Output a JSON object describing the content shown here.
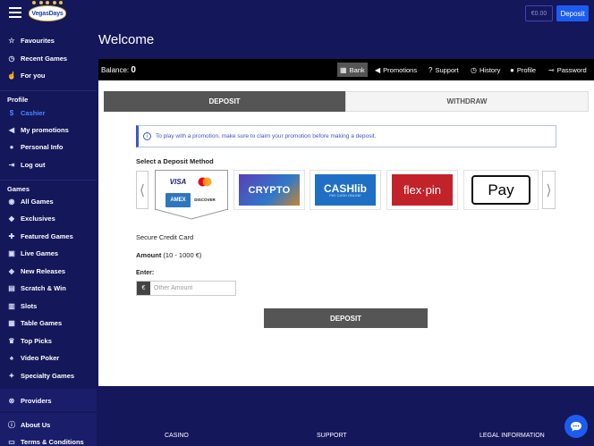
{
  "header": {
    "logo_text": "VegasDays",
    "balance_pill": "€0.00",
    "deposit_button": "Deposit"
  },
  "sidebar": {
    "top_items": [
      {
        "label": "Favourites",
        "icon": "star-icon"
      },
      {
        "label": "Recent Games",
        "icon": "clock-icon"
      },
      {
        "label": "For you",
        "icon": "thumbs-up-icon"
      }
    ],
    "profile_heading": "Profile",
    "profile_items": [
      {
        "label": "Cashier",
        "icon": "dollar-icon",
        "active": true
      },
      {
        "label": "My promotions",
        "icon": "megaphone-icon"
      },
      {
        "label": "Personal Info",
        "icon": "user-icon"
      },
      {
        "label": "Log out",
        "icon": "logout-icon"
      }
    ],
    "games_heading": "Games",
    "games_items": [
      {
        "label": "All Games",
        "icon": "grid-icon"
      },
      {
        "label": "Exclusives",
        "icon": "gem-icon"
      },
      {
        "label": "Featured Games",
        "icon": "puzzle-icon"
      },
      {
        "label": "Live Games",
        "icon": "cards-icon"
      },
      {
        "label": "New Releases",
        "icon": "tag-icon"
      },
      {
        "label": "Scratch & Win",
        "icon": "scratch-icon"
      },
      {
        "label": "Slots",
        "icon": "slots-icon"
      },
      {
        "label": "Table Games",
        "icon": "table-icon"
      },
      {
        "label": "Top Picks",
        "icon": "trophy-icon"
      },
      {
        "label": "Video Poker",
        "icon": "poker-icon"
      },
      {
        "label": "Specialty Games",
        "icon": "specialty-icon"
      }
    ],
    "providers": {
      "label": "Providers",
      "icon": "providers-icon"
    },
    "about": {
      "label": "About Us",
      "icon": "info-icon"
    },
    "terms": {
      "label": "Terms & Conditions",
      "icon": "document-icon"
    }
  },
  "main": {
    "title": "Welcome",
    "balance_label": "Balance:",
    "balance_value": "0",
    "nav": [
      {
        "label": "Bank",
        "icon": "bank-icon",
        "active": true
      },
      {
        "label": "Promotions",
        "icon": "megaphone-icon"
      },
      {
        "label": "Support",
        "icon": "question-icon"
      },
      {
        "label": "History",
        "icon": "history-icon"
      },
      {
        "label": "Profile",
        "icon": "user-icon"
      },
      {
        "label": "Password",
        "icon": "key-icon"
      }
    ],
    "tabs": {
      "deposit": "DEPOSIT",
      "withdraw": "WITHDRAW"
    },
    "info_message": "To play with a promotion, make sure to claim your promotion before making a deposit.",
    "method_title": "Select a Deposit Method",
    "methods": {
      "card": {
        "visa": "VISA",
        "mastercard": "MC",
        "amex": "AMEX",
        "discover": "DISCOVER"
      },
      "crypto": "CRYPTO",
      "cashlib": "CASHlib",
      "cashlib_sub": "PAY CASH ONLINE",
      "flexepin": "flex·pin",
      "applepay": " Pay"
    },
    "selected_method": "Secure Credit Card",
    "amount_label": "Amount",
    "amount_range": "(10 - 1000 €)",
    "enter_label": "Enter:",
    "currency_symbol": "€",
    "amount_placeholder": "Other Amount",
    "deposit_button": "DEPOSIT"
  },
  "footer": {
    "casino": "CASINO",
    "support": "SUPPORT",
    "legal": "LEGAL INFORMATION"
  }
}
